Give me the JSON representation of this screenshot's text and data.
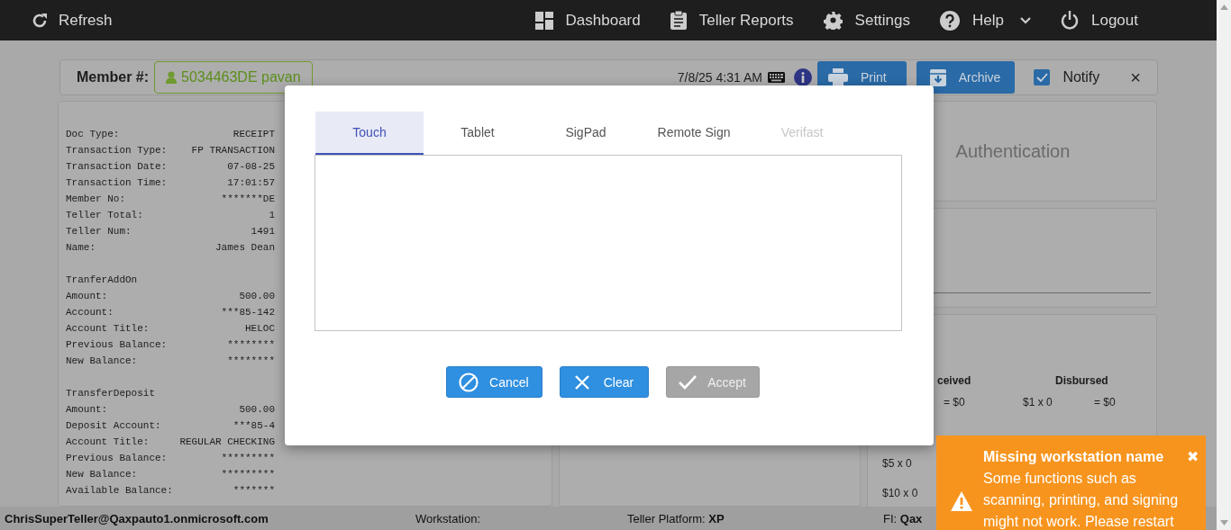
{
  "topbar": {
    "refresh": "Refresh",
    "nav": [
      {
        "label": "Dashboard",
        "kind": "dashboard",
        "has_menu": false
      },
      {
        "label": "Teller Reports",
        "kind": "reports",
        "has_menu": false
      },
      {
        "label": "Settings",
        "kind": "settings",
        "has_menu": false
      },
      {
        "label": "Help",
        "kind": "help",
        "has_menu": true
      },
      {
        "label": "Logout",
        "kind": "logout",
        "has_menu": false
      }
    ]
  },
  "member_bar": {
    "label": "Member #:",
    "member": "5034463DE pavan",
    "datetime": "7/8/25 4:31 AM",
    "buttons": [
      {
        "label": "Print",
        "kind": "print"
      },
      {
        "label": "Archive",
        "kind": "archive"
      }
    ],
    "notify": {
      "label": "Notify",
      "checked": true
    },
    "close": "×"
  },
  "receipt": {
    "sections": [
      {
        "rows": [
          {
            "label": "Doc Type:",
            "value": "RECEIPT"
          },
          {
            "label": "Transaction Type:",
            "value": "FP TRANSACTION"
          },
          {
            "label": "Transaction Date:",
            "value": "07-08-25"
          },
          {
            "label": "Transaction Time:",
            "value": "17:01:57"
          },
          {
            "label": "Member No:",
            "value": "*******DE"
          },
          {
            "label": "Teller Total:",
            "value": "1"
          },
          {
            "label": "Teller Num:",
            "value": "1491"
          },
          {
            "label": "Name:",
            "value": "James Dean"
          }
        ]
      },
      {
        "heading": "TranferAddOn",
        "rows": [
          {
            "label": "Amount:",
            "value": "500.00"
          },
          {
            "label": "Account:",
            "value": "***85-142"
          },
          {
            "label": "Account Title:",
            "value": "HELOC"
          },
          {
            "label": "Previous Balance:",
            "value": "********"
          },
          {
            "label": "New Balance:",
            "value": "********"
          }
        ]
      },
      {
        "heading": "TransferDeposit",
        "rows": [
          {
            "label": "Amount:",
            "value": "500.00"
          },
          {
            "label": "Deposit Account:",
            "value": "***85-4"
          },
          {
            "label": "Account Title:",
            "value": "REGULAR CHECKING"
          },
          {
            "label": "Previous Balance:",
            "value": "*********"
          },
          {
            "label": "New Balance:",
            "value": "*********"
          },
          {
            "label": "Available Balance:",
            "value": "*******"
          }
        ]
      }
    ]
  },
  "authentication": {
    "title": "Authentication"
  },
  "cash": {
    "received_header": "ceived",
    "disbursed_header": "Disbursed",
    "rows": [
      {
        "received_total": "= $0",
        "disbursed_denomination": "$1 x 0",
        "disbursed_total": "= $0"
      },
      {
        "received_denomination": "$5 x 0"
      },
      {
        "received_denomination": "$10 x 0"
      }
    ]
  },
  "status_bar": {
    "user": "ChrisSuperTeller@Qaxpauto1.onmicrosoft.com",
    "workstation": "Workstation:",
    "platform": "Teller Platform: **XP**",
    "fi": "FI: **Qax**"
  },
  "modal": {
    "tabs": [
      {
        "label": "Touch",
        "selected": true,
        "disabled": false
      },
      {
        "label": "Tablet",
        "selected": false,
        "disabled": false
      },
      {
        "label": "SigPad",
        "selected": false,
        "disabled": false
      },
      {
        "label": "Remote Sign",
        "selected": false,
        "disabled": false
      },
      {
        "label": "Verifast",
        "selected": false,
        "disabled": true
      }
    ],
    "buttons": [
      {
        "label": "Cancel",
        "kind": "cancel",
        "disabled": false
      },
      {
        "label": "Clear",
        "kind": "clear",
        "disabled": false
      },
      {
        "label": "Accept",
        "kind": "accept",
        "disabled": true
      }
    ]
  },
  "toast": {
    "title": "Missing workstation name",
    "message": "Some functions such as scanning, printing, and signing might not work. Please restart",
    "close": "✖"
  }
}
